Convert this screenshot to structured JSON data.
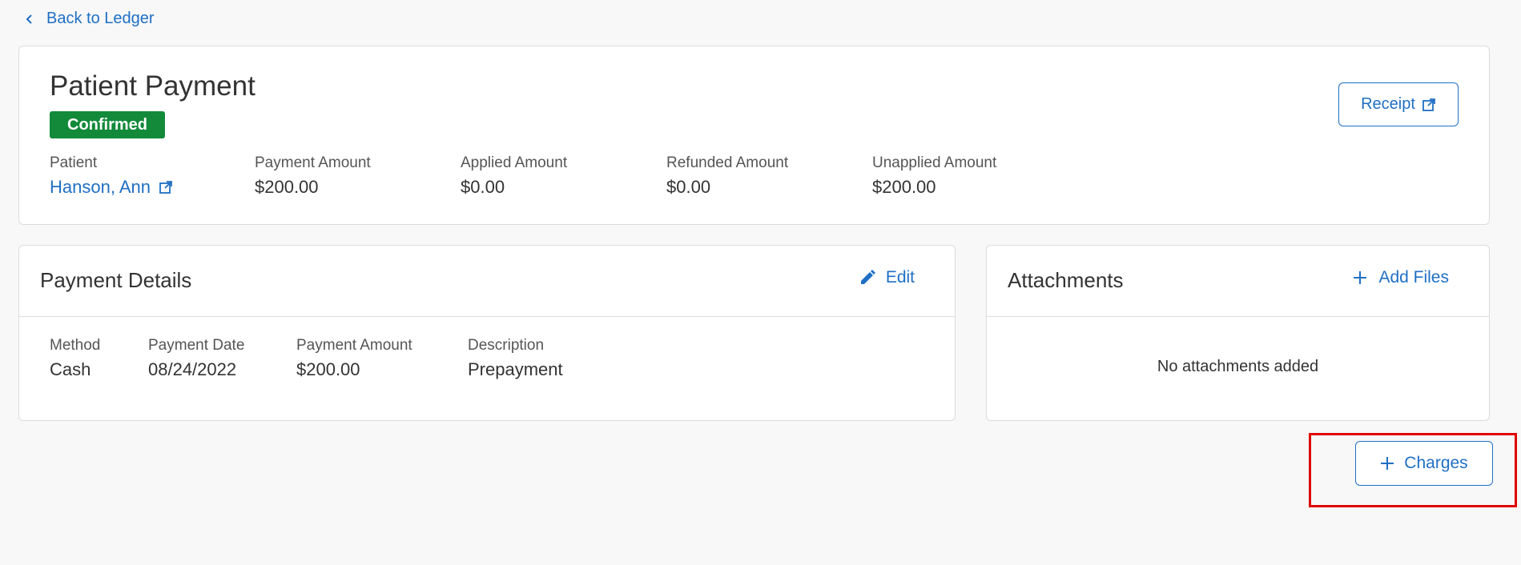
{
  "nav": {
    "back_label": "Back to Ledger"
  },
  "summary": {
    "title": "Patient Payment",
    "status": "Confirmed",
    "receipt_label": "Receipt",
    "fields": [
      {
        "label": "Patient",
        "value": "Hanson, Ann"
      },
      {
        "label": "Payment Amount",
        "value": "$200.00"
      },
      {
        "label": "Applied Amount",
        "value": "$0.00"
      },
      {
        "label": "Refunded Amount",
        "value": "$0.00"
      },
      {
        "label": "Unapplied Amount",
        "value": "$200.00"
      }
    ]
  },
  "payment_details": {
    "title": "Payment Details",
    "edit_label": "Edit",
    "fields": [
      {
        "label": "Method",
        "value": "Cash"
      },
      {
        "label": "Payment Date",
        "value": "08/24/2022"
      },
      {
        "label": "Payment Amount",
        "value": "$200.00"
      },
      {
        "label": "Description",
        "value": "Prepayment"
      }
    ]
  },
  "attachments": {
    "title": "Attachments",
    "add_label": "Add Files",
    "empty_message": "No attachments added"
  },
  "actions": {
    "charges_label": "Charges"
  },
  "colors": {
    "accent": "#1f6fc4",
    "status_confirmed": "#128a3a",
    "highlight": "#e00000"
  },
  "icons": [
    "chevron-left-icon",
    "external-link-icon",
    "pencil-icon",
    "plus-icon"
  ]
}
